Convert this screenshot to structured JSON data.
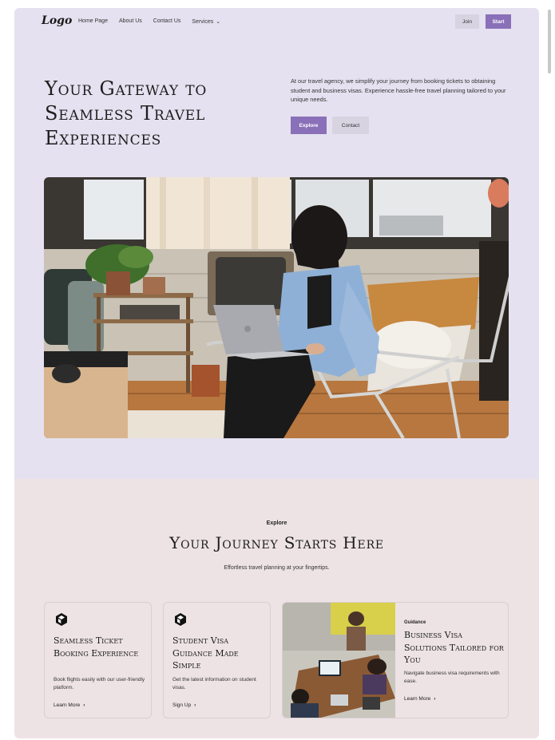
{
  "nav": {
    "logo": "Logo",
    "links": [
      "Home Page",
      "About Us",
      "Contact Us",
      "Services"
    ],
    "join_label": "Join",
    "start_label": "Start"
  },
  "hero": {
    "title": "Your Gateway to Seamless Travel Experiences",
    "description": "At our travel agency, we simplify your journey from booking tickets to obtaining student and business visas. Experience hassle-free travel planning tailored to your unique needs.",
    "explore_label": "Explore",
    "contact_label": "Contact"
  },
  "explore": {
    "eyebrow": "Explore",
    "title": "Your Journey Starts Here",
    "subtitle": "Effortless travel planning at your fingertips."
  },
  "cards": [
    {
      "title": "Seamless Ticket Booking Experience",
      "text": "Book flights easily with our user-friendly platform.",
      "link": "Learn More"
    },
    {
      "title": "Student Visa Guidance Made Simple",
      "text": "Get the latest information on student visas.",
      "link": "Sign Up"
    }
  ],
  "feature_card": {
    "tag": "Guidance",
    "title": "Business Visa Solutions Tailored for You",
    "text": "Navigate business visa requirements with ease.",
    "link": "Learn More"
  },
  "colors": {
    "accent": "#8a70b8",
    "hero_bg": "#e5e1f0",
    "section_bg": "#ede3e5"
  }
}
